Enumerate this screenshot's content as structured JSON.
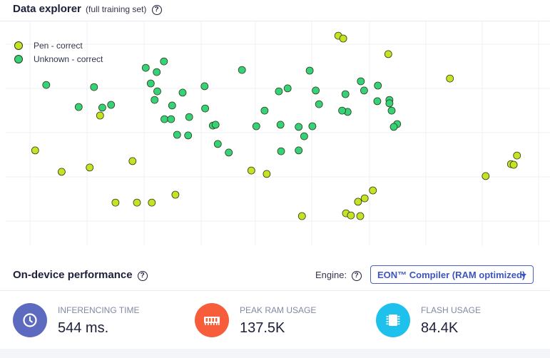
{
  "data_explorer": {
    "title": "Data explorer",
    "subtitle": "(full training set)",
    "help_icon": "question-circle-icon"
  },
  "chart_data": {
    "type": "scatter",
    "title": "",
    "xlabel": "",
    "ylabel": "",
    "xlim": [
      0,
      100
    ],
    "ylim": [
      0,
      100
    ],
    "grid": true,
    "legend_position": "top-left",
    "series": [
      {
        "name": "Pen - correct",
        "color": "#c5e324",
        "points": [
          [
            61.5,
            93.3
          ],
          [
            62.4,
            92.0
          ],
          [
            70.6,
            84.7
          ],
          [
            81.8,
            73.3
          ],
          [
            6.4,
            39.7
          ],
          [
            18.2,
            56.0
          ],
          [
            11.2,
            29.7
          ],
          [
            16.3,
            31.7
          ],
          [
            24.1,
            34.7
          ],
          [
            21.0,
            15.3
          ],
          [
            24.9,
            15.3
          ],
          [
            27.6,
            15.3
          ],
          [
            31.9,
            19.0
          ],
          [
            45.7,
            30.3
          ],
          [
            48.5,
            28.7
          ],
          [
            54.9,
            9.0
          ],
          [
            62.9,
            10.3
          ],
          [
            63.8,
            9.3
          ],
          [
            65.5,
            9.0
          ],
          [
            65.1,
            15.7
          ],
          [
            66.3,
            17.3
          ],
          [
            67.8,
            21.0
          ],
          [
            88.3,
            27.7
          ],
          [
            92.9,
            33.3
          ],
          [
            93.4,
            33.0
          ],
          [
            94.0,
            37.3
          ]
        ]
      },
      {
        "name": "Unknown - correct",
        "color": "#36d27a",
        "points": [
          [
            8.4,
            70.3
          ],
          [
            14.3,
            60.0
          ],
          [
            17.1,
            69.3
          ],
          [
            18.6,
            59.7
          ],
          [
            20.2,
            61.0
          ],
          [
            26.5,
            78.3
          ],
          [
            29.8,
            81.3
          ],
          [
            28.5,
            76.3
          ],
          [
            27.4,
            71.0
          ],
          [
            28.6,
            67.3
          ],
          [
            28.1,
            63.3
          ],
          [
            33.2,
            66.7
          ],
          [
            31.3,
            60.7
          ],
          [
            37.2,
            69.7
          ],
          [
            29.9,
            54.3
          ],
          [
            31.1,
            54.3
          ],
          [
            34.4,
            55.3
          ],
          [
            37.3,
            59.3
          ],
          [
            38.7,
            51.3
          ],
          [
            39.2,
            51.7
          ],
          [
            32.2,
            47.0
          ],
          [
            34.2,
            46.7
          ],
          [
            39.6,
            42.7
          ],
          [
            41.6,
            38.7
          ],
          [
            44.0,
            77.3
          ],
          [
            50.7,
            67.3
          ],
          [
            52.3,
            68.7
          ],
          [
            48.1,
            58.3
          ],
          [
            46.6,
            51.0
          ],
          [
            51.0,
            51.7
          ],
          [
            56.3,
            77.0
          ],
          [
            57.4,
            67.7
          ],
          [
            58.0,
            61.3
          ],
          [
            54.3,
            50.7
          ],
          [
            56.8,
            51.0
          ],
          [
            55.3,
            46.3
          ],
          [
            51.1,
            39.3
          ],
          [
            54.3,
            39.7
          ],
          [
            65.6,
            72.0
          ],
          [
            66.2,
            67.7
          ],
          [
            68.7,
            70.0
          ],
          [
            62.8,
            66.0
          ],
          [
            63.2,
            57.7
          ],
          [
            62.2,
            58.3
          ],
          [
            68.6,
            62.7
          ],
          [
            70.8,
            63.3
          ],
          [
            70.8,
            61.7
          ],
          [
            71.2,
            58.3
          ],
          [
            72.2,
            52.0
          ],
          [
            71.6,
            50.7
          ]
        ]
      }
    ]
  },
  "performance": {
    "title": "On-device performance",
    "engine_label": "Engine:",
    "engine_value": "EON™ Compiler (RAM optimized)",
    "metrics": [
      {
        "label": "INFERENCING TIME",
        "value": "544 ms.",
        "icon": "clock-icon",
        "color": "#5c6bc0"
      },
      {
        "label": "PEAK RAM USAGE",
        "value": "137.5K",
        "icon": "ram-chip-icon",
        "color": "#f75c3b"
      },
      {
        "label": "FLASH USAGE",
        "value": "84.4K",
        "icon": "cpu-chip-icon",
        "color": "#1ec1ec"
      }
    ]
  }
}
